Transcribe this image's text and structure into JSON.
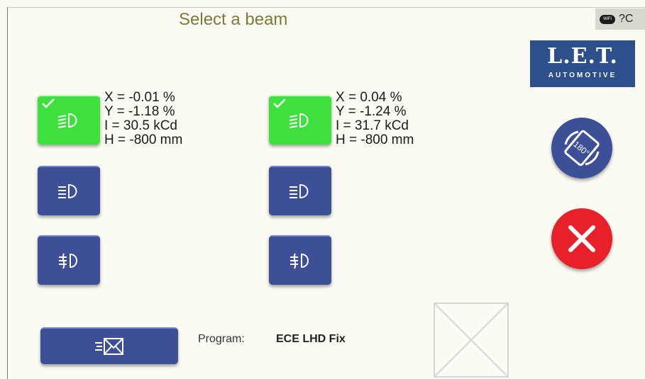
{
  "header": {
    "title": "Select a beam"
  },
  "status": {
    "wifi_label": "WiFi",
    "help_text": "?C"
  },
  "logo": {
    "line1": "L.E.T.",
    "line2": "AUTOMOTIVE"
  },
  "left": {
    "readout": [
      "X = -0.01 %",
      "Y = -1.18 %",
      "I = 30.5 kCd",
      "H = -800 mm"
    ],
    "beams": [
      {
        "icon": "low-beam-icon",
        "selected": true
      },
      {
        "icon": "high-beam-icon",
        "selected": false
      },
      {
        "icon": "fog-light-icon",
        "selected": false
      }
    ]
  },
  "right": {
    "readout": [
      "X = 0.04 %",
      "Y = -1.24 %",
      "I = 31.7 kCd",
      "H = -800 mm"
    ],
    "beams": [
      {
        "icon": "low-beam-icon",
        "selected": true
      },
      {
        "icon": "high-beam-icon",
        "selected": false
      },
      {
        "icon": "fog-light-icon",
        "selected": false
      }
    ]
  },
  "program": {
    "label": "Program:",
    "value": "ECE LHD Fix"
  },
  "buttons": {
    "send_icon": "send-mail-icon",
    "rotate_text": "180°",
    "rotate_icon": "rotate-180-icon",
    "cancel_icon": "close-icon"
  },
  "colors": {
    "accent": "#3d4f97",
    "selected": "#3ee03e",
    "cancel": "#e8202a",
    "title": "#7b7a3a",
    "logo": "#2d4f8c"
  }
}
